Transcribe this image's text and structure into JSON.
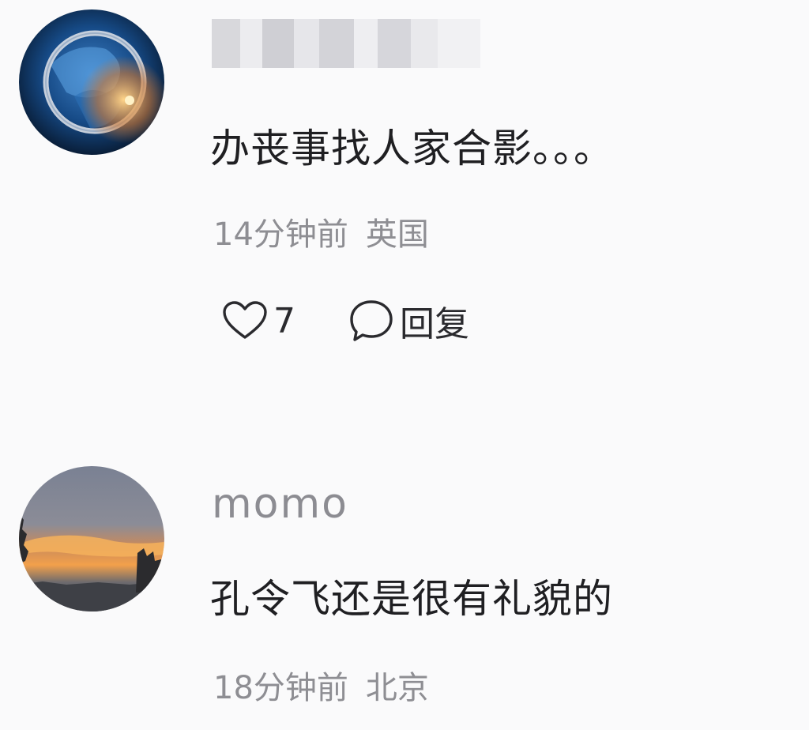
{
  "comments": [
    {
      "username": "",
      "username_obscured": true,
      "text": "办丧事找人家合影。。。",
      "time": "14分钟前",
      "location": "英国",
      "like_count": "7",
      "reply_label": "回复",
      "avatar_icon": "blue-glowing-ring-avatar"
    },
    {
      "username": "momo",
      "text": "孔令飞还是很有礼貌的",
      "time": "18分钟前",
      "location": "北京",
      "avatar_icon": "sunset-sky-avatar"
    }
  ],
  "icons": {
    "like": "heart-outline-icon",
    "reply": "speech-bubble-outline-icon"
  },
  "colors": {
    "background": "#fafafb",
    "text_primary": "#1f1f22",
    "text_secondary": "#8e8e93"
  }
}
